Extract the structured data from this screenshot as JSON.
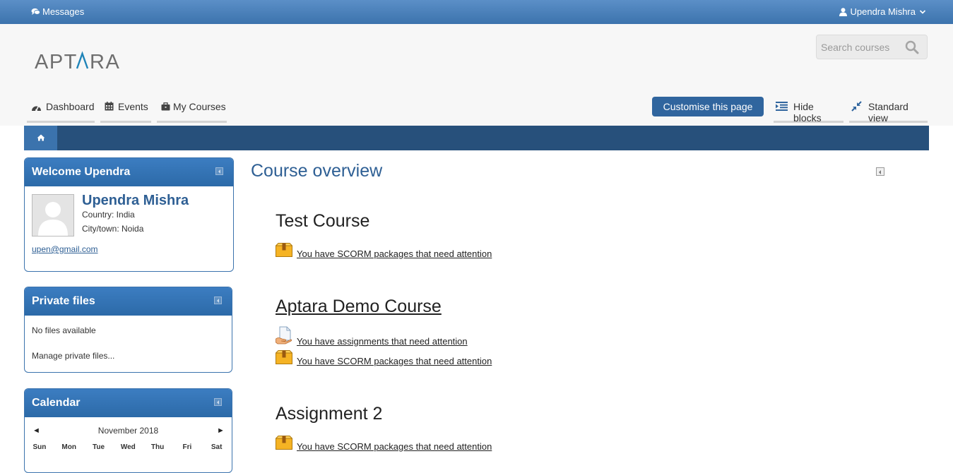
{
  "topbar": {
    "messages_label": "Messages",
    "user_name": "Upendra Mishra"
  },
  "header": {
    "logo_text": "APTARA",
    "search_placeholder": "Search courses",
    "nav": [
      {
        "label": "Dashboard",
        "icon": "dashboard-icon"
      },
      {
        "label": "Events",
        "icon": "calendar-icon"
      },
      {
        "label": "My Courses",
        "icon": "briefcase-icon"
      }
    ],
    "customise_button": "Customise this page",
    "hide_blocks": "Hide blocks",
    "standard_view": "Standard view"
  },
  "breadcrumb": {
    "home_icon": "home-icon"
  },
  "welcome_block": {
    "title": "Welcome Upendra",
    "name": "Upendra Mishra",
    "country": "Country: India",
    "city": "City/town: Noida",
    "email": "upen@gmail.com"
  },
  "private_files_block": {
    "title": "Private files",
    "empty_text": "No files available",
    "manage_link": "Manage private files..."
  },
  "calendar_block": {
    "title": "Calendar",
    "month": "November 2018",
    "prev": "◄",
    "next": "►",
    "days": [
      "Sun",
      "Mon",
      "Tue",
      "Wed",
      "Thu",
      "Fri",
      "Sat"
    ]
  },
  "main": {
    "title": "Course overview",
    "courses": [
      {
        "name": "Test Course",
        "alerts": [
          "You have SCORM packages that need attention"
        ]
      },
      {
        "name": "Aptara Demo Course",
        "alerts": [
          "You have assignments that need attention",
          "You have SCORM packages that need attention"
        ]
      },
      {
        "name": "Assignment 2",
        "alerts": [
          "You have SCORM packages that need attention"
        ]
      }
    ]
  },
  "colors": {
    "topbar": "#4a80bb",
    "navy_bar": "#27507b",
    "accent": "#2e5f94",
    "button": "#30659e"
  }
}
